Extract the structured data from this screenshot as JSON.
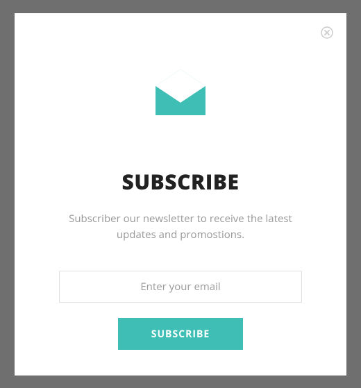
{
  "modal": {
    "title": "SUBSCRIBE",
    "subtitle": "Subscriber our newsletter to receive the latest updates and promostions.",
    "email_placeholder": "Enter your email",
    "submit_label": "SUBSCRIBE"
  },
  "colors": {
    "accent": "#3ebeb4"
  }
}
